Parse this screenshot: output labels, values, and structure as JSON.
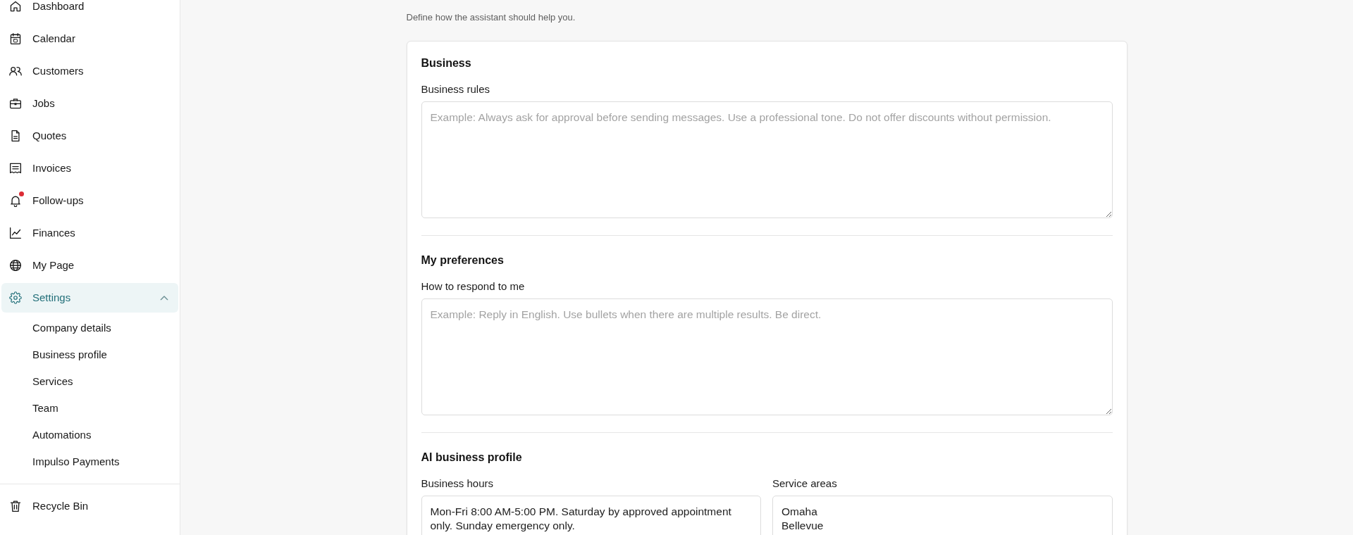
{
  "sidebar": {
    "items": [
      {
        "label": "Dashboard",
        "selected": false,
        "alert": false
      },
      {
        "label": "Calendar",
        "selected": false,
        "alert": false
      },
      {
        "label": "Customers",
        "selected": false,
        "alert": false
      },
      {
        "label": "Jobs",
        "selected": false,
        "alert": false
      },
      {
        "label": "Quotes",
        "selected": false,
        "alert": false
      },
      {
        "label": "Invoices",
        "selected": false,
        "alert": false
      },
      {
        "label": "Follow-ups",
        "selected": false,
        "alert": true
      },
      {
        "label": "Finances",
        "selected": false,
        "alert": false
      },
      {
        "label": "My Page",
        "selected": false,
        "alert": false
      },
      {
        "label": "Settings",
        "selected": true,
        "alert": false,
        "expanded": true,
        "children": [
          {
            "label": "Company details",
            "selected": false
          },
          {
            "label": "Business profile",
            "selected": false
          },
          {
            "label": "Services",
            "selected": false
          },
          {
            "label": "Team",
            "selected": false
          },
          {
            "label": "Automations",
            "selected": false
          },
          {
            "label": "Impulso Payments",
            "selected": false
          }
        ]
      }
    ],
    "footer_items": [
      {
        "label": "Recycle Bin",
        "selected": false,
        "alert": false
      }
    ]
  },
  "page": {
    "subtitle": "Define how the assistant should help you.",
    "sections": [
      {
        "title": "Business",
        "fields": [
          {
            "label": "Business rules",
            "placeholder": "Example: Always ask for approval before sending messages. Use a professional tone. Do not offer discounts without permission."
          }
        ]
      },
      {
        "title": "My preferences",
        "fields": [
          {
            "label": "How to respond to me",
            "placeholder": "Example: Reply in English. Use bullets when there are multiple results. Be direct."
          }
        ]
      },
      {
        "title": "AI business profile",
        "fields": [
          {
            "label": "Business hours",
            "value": "Mon-Fri 8:00 AM-5:00 PM. Saturday by approved appointment only. Sunday emergency only."
          },
          {
            "label": "Service areas",
            "value": "Omaha\nBellevue"
          }
        ]
      }
    ]
  }
}
